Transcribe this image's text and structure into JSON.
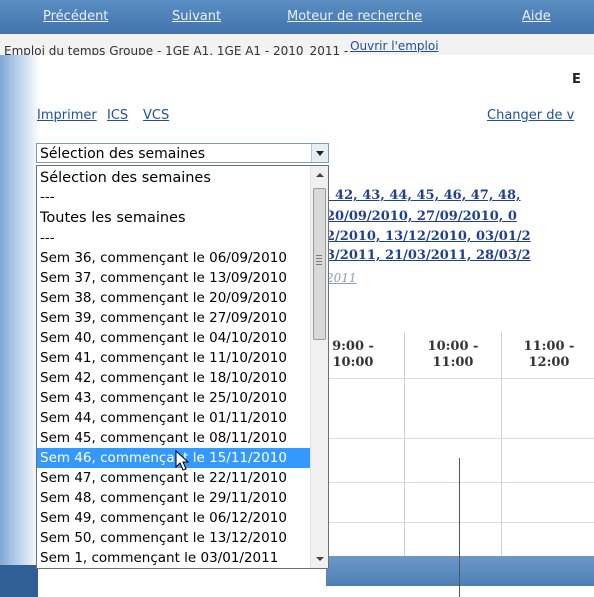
{
  "nav": {
    "prev": "Précédent",
    "next": "Suivant",
    "search": "Moteur de recherche",
    "help": "Aide"
  },
  "header": {
    "title": "Emploi du temps Groupe - 1GE A1, 1GE A1 - 2010_2011 - ",
    "open_link": "Ouvrir l'emploi"
  },
  "heading_fragment": "E",
  "links": {
    "print": "Imprimer",
    "ics": "ICS",
    "vcs": "VCS",
    "change_view": "Changer de v"
  },
  "week_select": {
    "selected_value": "Sélection des semaines",
    "options": [
      "Sélection des semaines",
      "---",
      "Toutes les semaines",
      "---",
      "Sem 36, commençant le 06/09/2010",
      "Sem 37, commençant le 13/09/2010",
      "Sem 38, commençant le 20/09/2010",
      "Sem 39, commençant le 27/09/2010",
      "Sem 40, commençant le 04/10/2010",
      "Sem 41, commençant le 11/10/2010",
      "Sem 42, commençant le 18/10/2010",
      "Sem 43, commençant le 25/10/2010",
      "Sem 44, commençant le 01/11/2010",
      "Sem 45, commençant le 08/11/2010",
      "Sem 46, commençant le 15/11/2010",
      "Sem 47, commençant le 22/11/2010",
      "Sem 48, commençant le 29/11/2010",
      "Sem 49, commençant le 06/12/2010",
      "Sem 50, commençant le 13/12/2010",
      "Sem 1, commençant le 03/01/2011"
    ],
    "highlighted_index": 14
  },
  "background_weeks": {
    "row1": ", 42, 43, 44, 45, 46, 47, 48, ",
    "row2": " 20/09/2010, 27/09/2010, 0",
    "row3": "2/2010, 13/12/2010, 03/01/2",
    "row4": "3/2011, 21/03/2011, 28/03/2",
    "row5": "2011"
  },
  "timetable": {
    "headers": [
      "9:00 -\n10:00",
      "10:00 -\n11:00",
      "11:00 -\n12:00"
    ]
  },
  "colors": {
    "nav_bg": "#4a7fb6",
    "link": "#1f4fa0",
    "selection": "#3399ff"
  }
}
